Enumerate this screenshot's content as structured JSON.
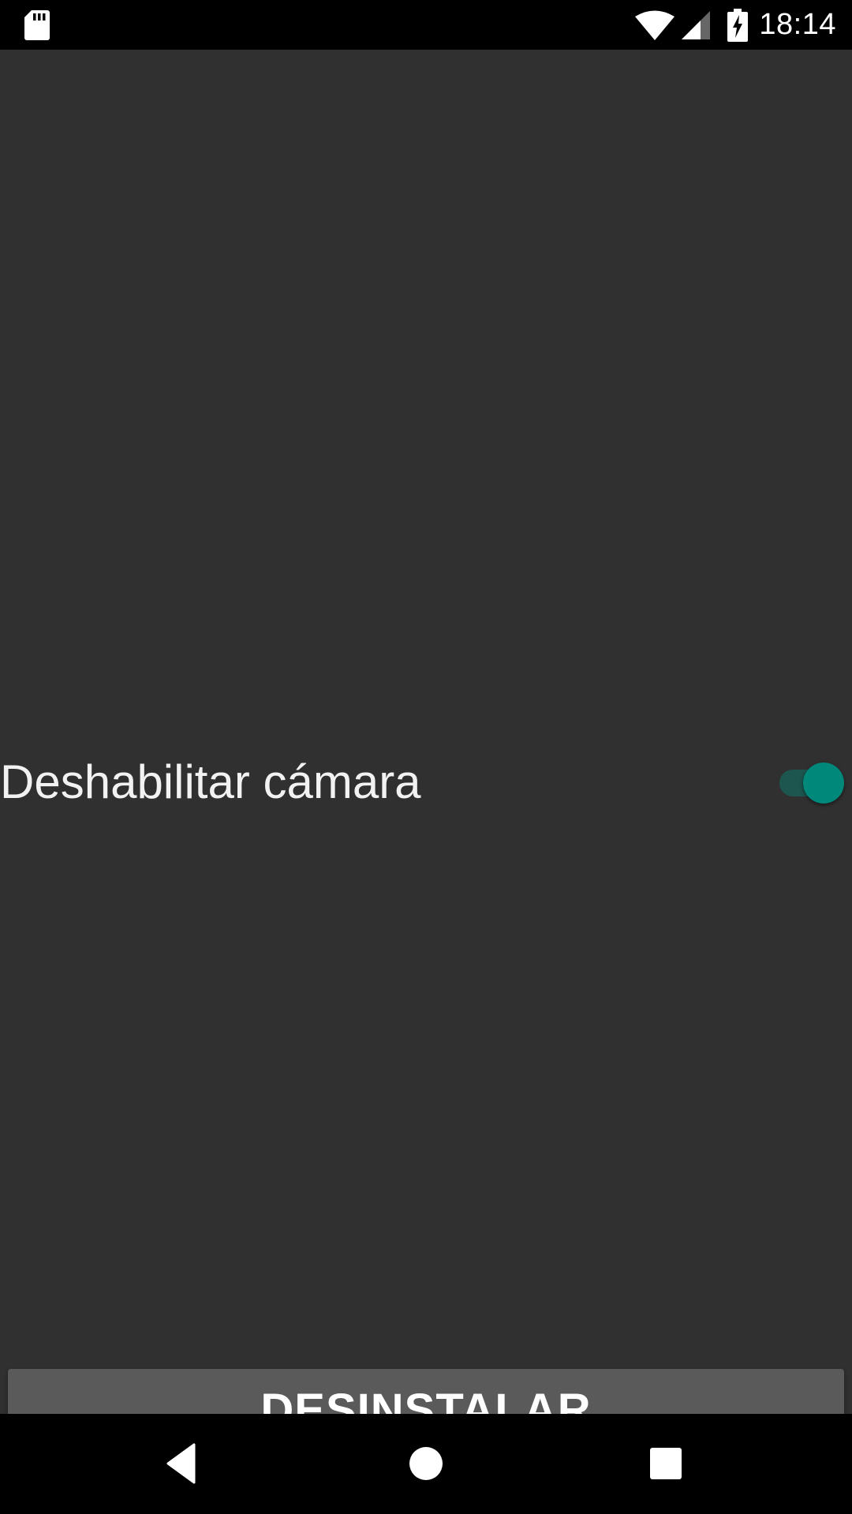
{
  "status_bar": {
    "time": "18:14",
    "icons": [
      "sd-card-icon",
      "wifi-icon",
      "cell-signal-icon",
      "battery-charging-icon"
    ]
  },
  "settings": {
    "disable_camera": {
      "label": "Deshabilitar cámara",
      "enabled": true,
      "accent_color": "#00897b"
    }
  },
  "actions": {
    "uninstall_label": "DESINSTALAR"
  },
  "nav_bar": {
    "icons": [
      "back-icon",
      "home-icon",
      "recents-icon"
    ]
  }
}
